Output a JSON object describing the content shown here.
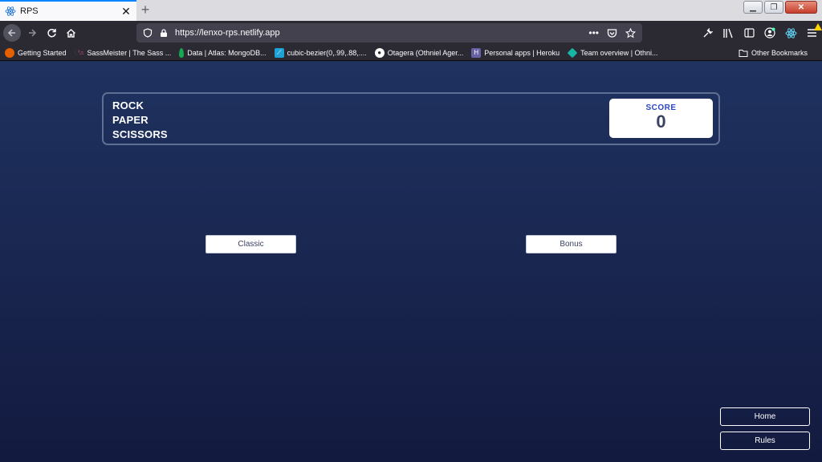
{
  "browser": {
    "tab_title": "RPS",
    "tab_close": "✕",
    "new_tab": "+",
    "url": "https://lenxo-rps.netlify.app",
    "icons": {
      "back": "arrow-left",
      "forward": "arrow-right",
      "reload": "reload",
      "home": "home",
      "shield": "shield",
      "lock": "lock",
      "more": "ellipsis",
      "pocket": "pocket",
      "bookmark_star": "star",
      "tools": [
        "wrench",
        "library",
        "sidebar",
        "account",
        "react-devtools",
        "menu"
      ]
    },
    "bookmarks": [
      {
        "label": "Getting Started",
        "color": "#e66000",
        "icon": "firefox-icon"
      },
      {
        "label": "SassMeister | The Sass ...",
        "color": "#c6538c",
        "icon": "sassmeister-icon"
      },
      {
        "label": "Data | Atlas: MongoDB...",
        "color": "#13aa52",
        "icon": "mongodb-icon"
      },
      {
        "label": "cubic-bezier(0,.99,.88,....",
        "color": "#1fa2d6",
        "icon": "cubic-bezier-icon"
      },
      {
        "label": "Otagera (Othniel Ager...",
        "color": "#ffffff",
        "icon": "github-icon"
      },
      {
        "label": "Personal apps | Heroku",
        "color": "#6762a6",
        "icon": "heroku-icon"
      },
      {
        "label": "Team overview | Othni...",
        "color": "#16b6a4",
        "icon": "team-icon"
      }
    ],
    "other_bookmarks": "Other Bookmarks"
  },
  "game": {
    "logo_lines": [
      "ROCK",
      "PAPER",
      "SCISSORS"
    ],
    "score_label": "SCORE",
    "score_value": "0",
    "classic_label": "Classic",
    "bonus_label": "Bonus",
    "home_label": "Home",
    "rules_label": "Rules"
  },
  "colors": {
    "tab_accent": "#0a84ff",
    "page_bg_top": "#1f3260",
    "page_bg_bottom": "#131a3f",
    "score_label": "#2a46c0",
    "score_value": "#3b4363"
  }
}
